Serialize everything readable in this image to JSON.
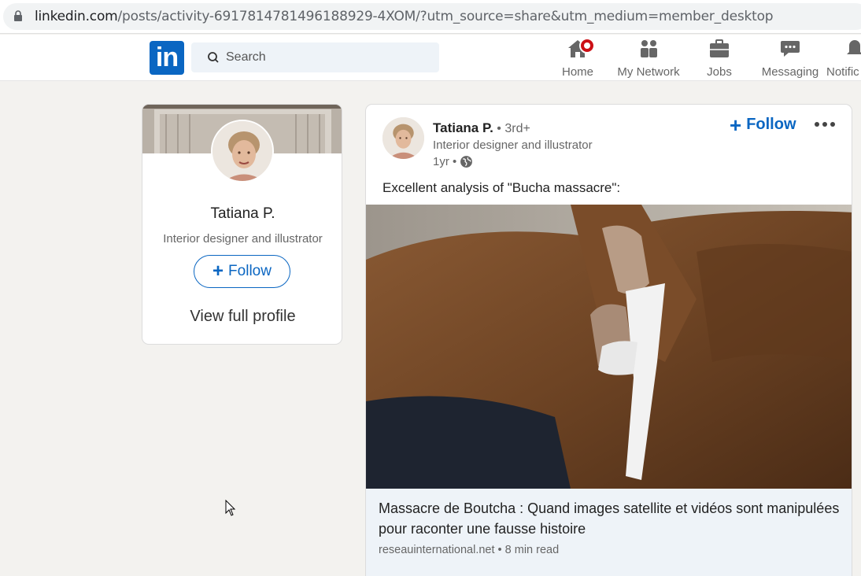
{
  "browser": {
    "url_host": "linkedin.com",
    "url_path": "/posts/activity-6917814781496188929-4XOM/?utm_source=share&utm_medium=member_desktop"
  },
  "header": {
    "logo_text": "in",
    "search_placeholder": "Search",
    "nav": {
      "home": "Home",
      "network": "My Network",
      "jobs": "Jobs",
      "messaging": "Messaging",
      "notifications": "Notific"
    }
  },
  "profile_card": {
    "name": "Tatiana P.",
    "headline": "Interior designer and illustrator",
    "follow_label": "Follow",
    "view_profile_label": "View full profile"
  },
  "post": {
    "author_name": "Tatiana P.",
    "degree": " • 3rd+",
    "author_headline": "Interior designer and illustrator",
    "time": "1yr •",
    "follow_label": "Follow",
    "text": "Excellent analysis of \"Bucha massacre\":",
    "article": {
      "title": "Massacre de Boutcha : Quand images satellite et vidéos sont manipulées pour raconter une fausse histoire",
      "source": "reseauinternational.net • 8 min read"
    }
  },
  "colors": {
    "brand": "#0a66c2",
    "badge": "#cc1016",
    "background": "#f3f2ef"
  }
}
